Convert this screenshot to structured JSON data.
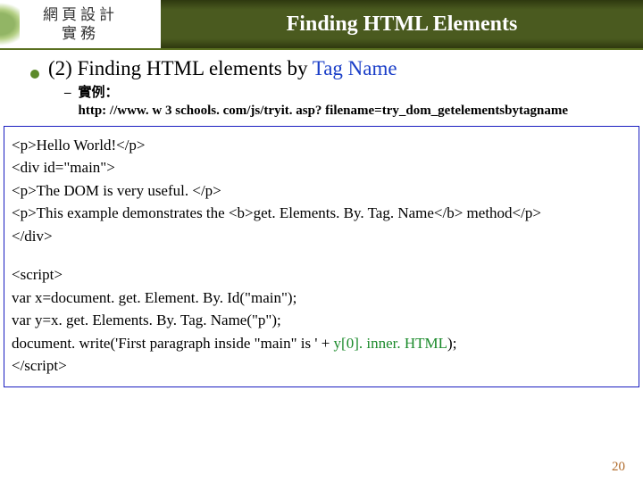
{
  "header": {
    "left_line1": "網頁設計",
    "left_line2": "實務",
    "title": "Finding HTML Elements"
  },
  "bullet": {
    "prefix": "(2) Finding HTML elements by ",
    "link": "Tag Name"
  },
  "sub": {
    "dash": "–",
    "label": "實例：",
    "url": "http: //www. w 3 schools. com/js/tryit. asp? filename=try_dom_getelementsbytagname"
  },
  "code1": {
    "l1": "<p>Hello World!</p>",
    "l2": "<div id=\"main\">",
    "l3": "<p>The DOM is very useful. </p>",
    "l4": "<p>This example demonstrates the <b>get. Elements. By. Tag. Name</b> method</p>",
    "l5": "</div>"
  },
  "code2": {
    "l1": "<script>",
    "l2": "var x=document. get. Element. By. Id(\"main\");",
    "l3": "var y=x. get. Elements. By. Tag. Name(\"p\");",
    "l4_a": "document. write('First paragraph inside \"main\" is ' + ",
    "l4_b": "y[0]. inner. HTML",
    "l4_c": ");",
    "l5": "</script>"
  },
  "page_number": "20"
}
